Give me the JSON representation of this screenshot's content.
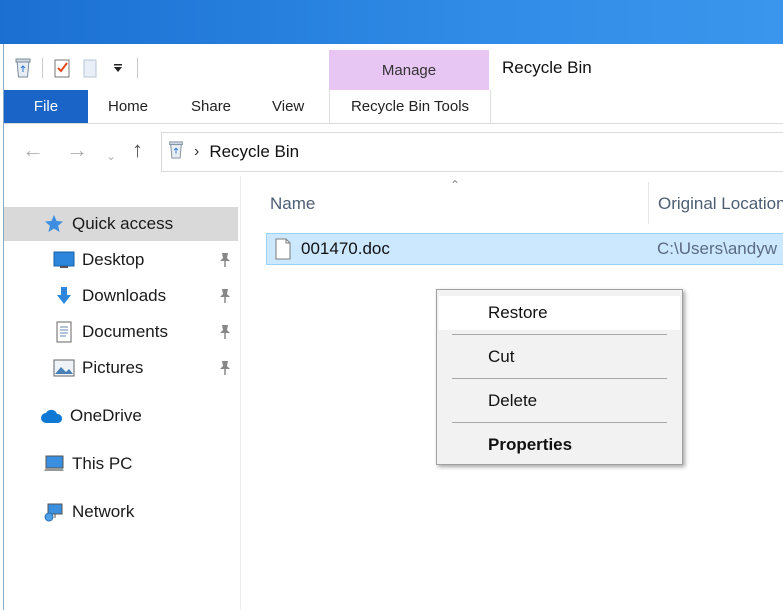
{
  "window": {
    "title": "Recycle Bin",
    "contextual_group_label": "Manage"
  },
  "ribbon": {
    "tabs": [
      {
        "label": "File"
      },
      {
        "label": "Home"
      },
      {
        "label": "Share"
      },
      {
        "label": "View"
      },
      {
        "label": "Recycle Bin Tools"
      }
    ]
  },
  "address_bar": {
    "breadcrumb": "Recycle Bin"
  },
  "sidebar": {
    "items": [
      {
        "label": "Quick access",
        "icon": "star-icon"
      },
      {
        "label": "Desktop",
        "icon": "desktop-icon",
        "pinned": true
      },
      {
        "label": "Downloads",
        "icon": "download-icon",
        "pinned": true
      },
      {
        "label": "Documents",
        "icon": "documents-icon",
        "pinned": true
      },
      {
        "label": "Pictures",
        "icon": "pictures-icon",
        "pinned": true
      },
      {
        "label": "OneDrive",
        "icon": "cloud-icon"
      },
      {
        "label": "This PC",
        "icon": "computer-icon"
      },
      {
        "label": "Network",
        "icon": "network-icon"
      }
    ]
  },
  "file_list": {
    "columns": [
      "Name",
      "Original Location"
    ],
    "rows": [
      {
        "name": "001470.doc",
        "original_location": "C:\\Users\\andyw"
      }
    ]
  },
  "context_menu": {
    "items": [
      {
        "label": "Restore"
      },
      {
        "label": "Cut"
      },
      {
        "label": "Delete"
      },
      {
        "label": "Properties"
      }
    ]
  },
  "colors": {
    "file_tab": "#1a63c7",
    "manage_tab": "#e8c6f3",
    "selection": "#cce8ff"
  }
}
